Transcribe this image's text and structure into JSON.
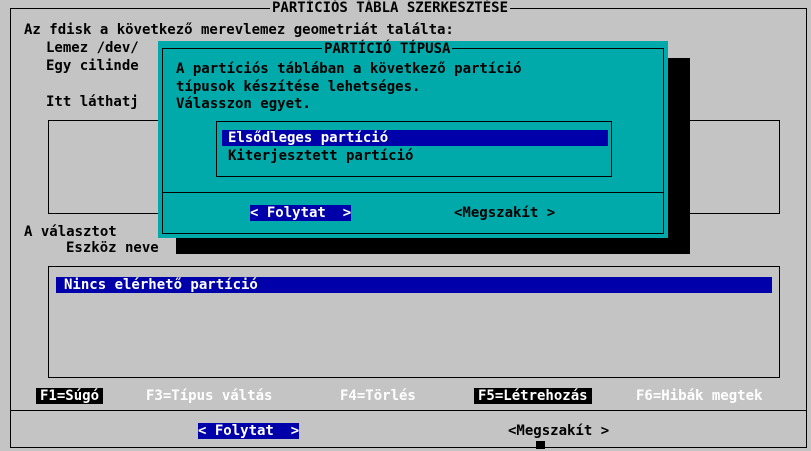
{
  "window": {
    "title": "PARTÍCIÓS TÁBLA SZERKESZTÉSE",
    "line1": "Az fdisk a következő merevlemez geometriát találta:",
    "line2": "Lemez /dev/",
    "line3": "Egy cilinde",
    "line4": "Itt láthatj",
    "line5": "A választot",
    "line6": "Eszköz neve"
  },
  "partitions": {
    "items": [
      {
        "label": "Nincs elérhető partíció",
        "selected": true
      }
    ]
  },
  "fkeys": [
    {
      "label": "F1=Súgó",
      "highlighted": true
    },
    {
      "label": "F3=Típus váltás",
      "highlighted": false
    },
    {
      "label": "F4=Törlés",
      "highlighted": false
    },
    {
      "label": "F5=Létrehozás",
      "highlighted": true
    },
    {
      "label": "F6=Hibák megtek",
      "highlighted": false
    }
  ],
  "buttons": {
    "continue": "< Folytat  >",
    "cancel": "<Megszakít >"
  },
  "dialog": {
    "title": "PARTÍCIÓ TÍPUSA",
    "text1": "A partíciós táblában a következő partíció",
    "text2": "típusok készítése lehetséges.",
    "text3": "Válasszon egyet.",
    "options": [
      {
        "label": "Elsődleges partíció",
        "selected": true
      },
      {
        "label": "Kiterjesztett partíció",
        "selected": false
      }
    ],
    "continue": "< Folytat  >",
    "cancel": "<Megszakít >"
  },
  "colors": {
    "background": "#c4c4c4",
    "dialog": "#00aaaa",
    "selection": "#0000aa"
  }
}
